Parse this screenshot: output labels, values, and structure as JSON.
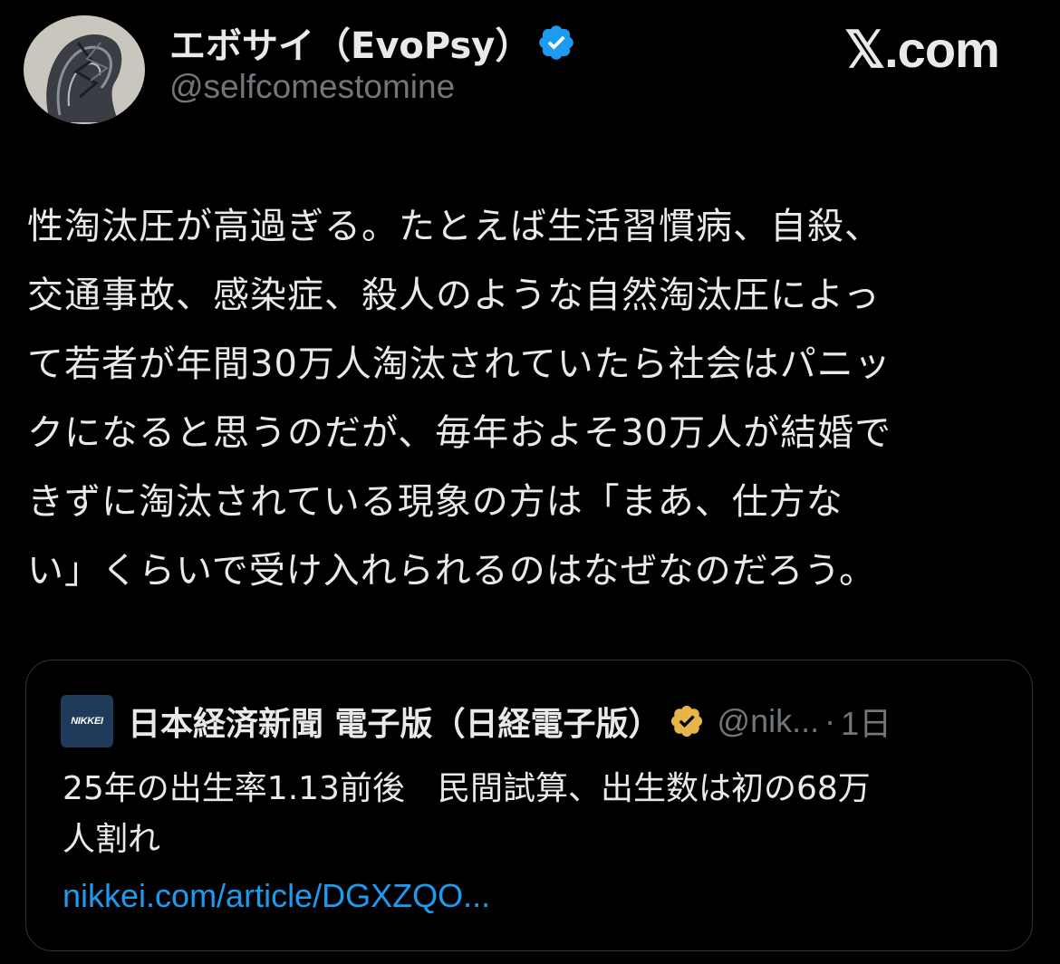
{
  "author": {
    "display_name": "エボサイ（EvoPsy）",
    "handle": "@selfcomestomine",
    "verified_color": "#1d9bf0"
  },
  "site": {
    "mark": "𝕏.com"
  },
  "tweet": {
    "lines": [
      "性淘汰圧が高過ぎる。たとえば生活習慣病、自殺、",
      "交通事故、感染症、殺人のような自然淘汰圧によっ",
      "て若者が年間30万人淘汰されていたら社会はパニッ",
      "クになると思うのだが、毎年およそ30万人が結婚で",
      "きずに淘汰されている現象の方は「まあ、仕方な",
      "い」くらいで受け入れられるのはなぜなのだろう。"
    ]
  },
  "quote": {
    "logo_text": "NIKKEI",
    "name": "日本経済新聞 電子版（日経電子版）",
    "verified_color": "#e8b54a",
    "handle": "@nik...",
    "separator": "·",
    "time": "1日",
    "text_lines": [
      "25年の出生率1.13前後　民間試算、出生数は初の68万",
      "人割れ"
    ],
    "link": "nikkei.com/article/DGXZQO..."
  },
  "colors": {
    "background": "#000000",
    "text": "#e7e9ea",
    "muted": "#71767b",
    "link": "#1d9bf0",
    "border": "#2f3336"
  }
}
